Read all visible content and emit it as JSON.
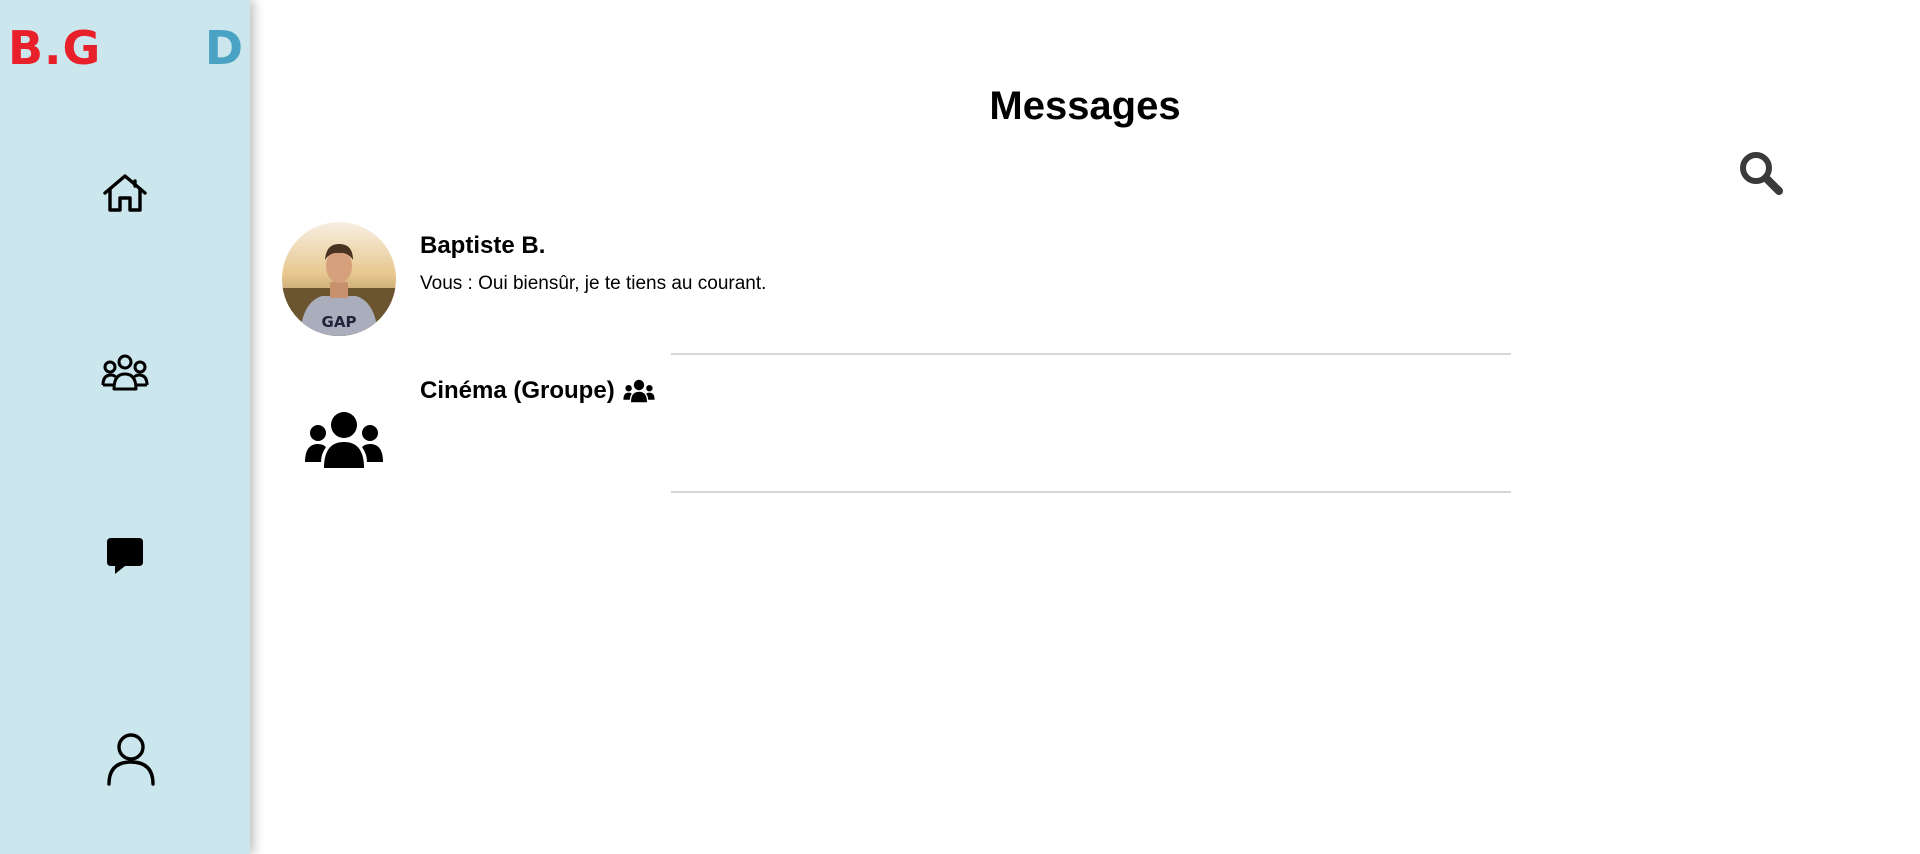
{
  "brand": {
    "left_text": "B.G",
    "right_text": "D",
    "left_color": "#e8202a",
    "right_color": "#4aa3c4"
  },
  "sidebar": {
    "background": "#cbe6ec",
    "items": [
      {
        "icon": "home-icon"
      },
      {
        "icon": "groups-icon"
      },
      {
        "icon": "chat-bubble-icon"
      },
      {
        "icon": "user-icon"
      }
    ]
  },
  "header": {
    "title": "Messages",
    "search_icon": "search-icon"
  },
  "conversations": [
    {
      "name": "Baptiste B.",
      "preview": "Vous : Oui biensûr, je te tiens au courant.",
      "avatar": "photo"
    },
    {
      "name": "Cinéma (Groupe)",
      "preview": "",
      "avatar": "groups-icon",
      "badge_icon": "groups-icon"
    }
  ]
}
